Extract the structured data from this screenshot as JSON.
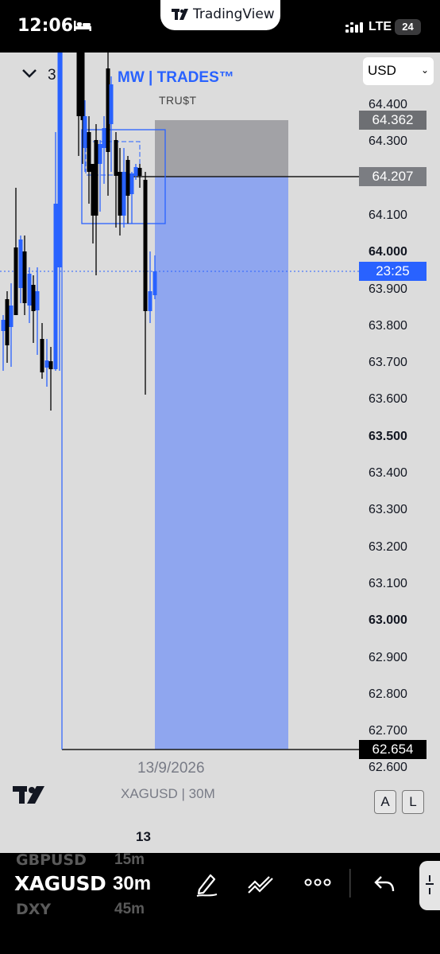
{
  "status_bar": {
    "time": "12:06",
    "network": "LTE",
    "battery": "24",
    "app_pill": "TradingView"
  },
  "chart": {
    "collapse_count": "3",
    "indicator_title": "MW | TRADES™",
    "trust_label": "TRU$T",
    "currency": "USD",
    "price_ticks": [
      {
        "label": "64.400",
        "bold": false
      },
      {
        "label": "64.300",
        "bold": false
      },
      {
        "label": "64.100",
        "bold": false
      },
      {
        "label": "64.000",
        "bold": true
      },
      {
        "label": "63.900",
        "bold": false
      },
      {
        "label": "63.800",
        "bold": false
      },
      {
        "label": "63.700",
        "bold": false
      },
      {
        "label": "63.600",
        "bold": false
      },
      {
        "label": "63.500",
        "bold": true
      },
      {
        "label": "63.400",
        "bold": false
      },
      {
        "label": "63.300",
        "bold": false
      },
      {
        "label": "63.200",
        "bold": false
      },
      {
        "label": "63.100",
        "bold": false
      },
      {
        "label": "63.000",
        "bold": true
      },
      {
        "label": "62.900",
        "bold": false
      },
      {
        "label": "62.800",
        "bold": false
      },
      {
        "label": "62.700",
        "bold": false
      },
      {
        "label": "62.600",
        "bold": false
      }
    ],
    "price_labels": {
      "stop": "64.362",
      "entry": "64.207",
      "countdown": "23:25",
      "target": "62.654"
    },
    "date_label": "13/9/2026",
    "symbol_label": "XAGUSD | 30M",
    "time_axis_label": "13",
    "scale_buttons": [
      "A",
      "L"
    ],
    "colors": {
      "bull": "#2962ff",
      "bear": "#000000",
      "target_zone": "#8fa6ef",
      "stop_zone": "#a2a2a6",
      "background": "#dcdcdc"
    }
  },
  "bottom_bar": {
    "symbol_prev": "GBPUSD",
    "symbol": "XAGUSD",
    "symbol_next": "DXY",
    "timeframe_prev": "15m",
    "timeframe": "30m",
    "timeframe_next": "45m",
    "tools": [
      "pen-icon",
      "drawing-tools-icon",
      "more-icon",
      "undo-icon"
    ]
  }
}
